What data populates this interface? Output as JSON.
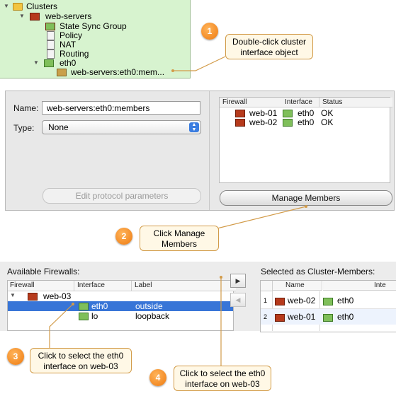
{
  "tree": {
    "items": [
      {
        "label": "Clusters",
        "icon": "folder-icon"
      },
      {
        "label": "web-servers",
        "icon": "cluster-icon"
      },
      {
        "label": "State Sync Group",
        "icon": "state-sync-icon"
      },
      {
        "label": "Policy",
        "icon": "policy-icon"
      },
      {
        "label": "NAT",
        "icon": "nat-icon"
      },
      {
        "label": "Routing",
        "icon": "routing-icon"
      },
      {
        "label": "eth0",
        "icon": "interface-icon"
      },
      {
        "label": "web-servers:eth0:mem...",
        "icon": "member-group-icon"
      }
    ]
  },
  "dialog": {
    "name_label": "Name:",
    "name_value": "web-servers:eth0:members",
    "type_label": "Type:",
    "type_value": "None",
    "edit_protocol_label": "Edit protocol parameters",
    "manage_members_label": "Manage Members",
    "members_table": {
      "headers": [
        "Firewall",
        "Interface",
        "Status"
      ],
      "rows": [
        {
          "firewall": "web-01",
          "interface": "eth0",
          "status": "OK"
        },
        {
          "firewall": "web-02",
          "interface": "eth0",
          "status": "OK"
        }
      ]
    }
  },
  "cluster_members": {
    "available_title": "Available Firewalls:",
    "selected_title": "Selected as Cluster-Members:",
    "available_headers": [
      "Firewall",
      "Interface",
      "Label"
    ],
    "available_rows": [
      {
        "firewall": "web-03",
        "interface": "",
        "label": ""
      },
      {
        "firewall": "",
        "interface": "eth0",
        "label": "outside"
      },
      {
        "firewall": "",
        "interface": "lo",
        "label": "loopback"
      }
    ],
    "selected_headers": [
      "Name",
      "Inte"
    ],
    "selected_rows": [
      {
        "num": "1",
        "name": "web-02",
        "interface": "eth0"
      },
      {
        "num": "2",
        "name": "web-01",
        "interface": "eth0"
      }
    ],
    "add_arrow": "▶",
    "remove_arrow": "◀"
  },
  "callouts": [
    {
      "num": "1",
      "text": "Double-click cluster interface object"
    },
    {
      "num": "2",
      "text": "Click Manage Members"
    },
    {
      "num": "3",
      "text": "Click to select the eth0 interface on web-03"
    },
    {
      "num": "4",
      "text": "Click to select the eth0 interface on web-03"
    }
  ],
  "colors": {
    "tree_bg": "#d7f3cf",
    "selection": "#3875d7",
    "callout_border": "#d29b49",
    "callout_bg": "#fff8e6",
    "badge": "#ee7a10"
  }
}
